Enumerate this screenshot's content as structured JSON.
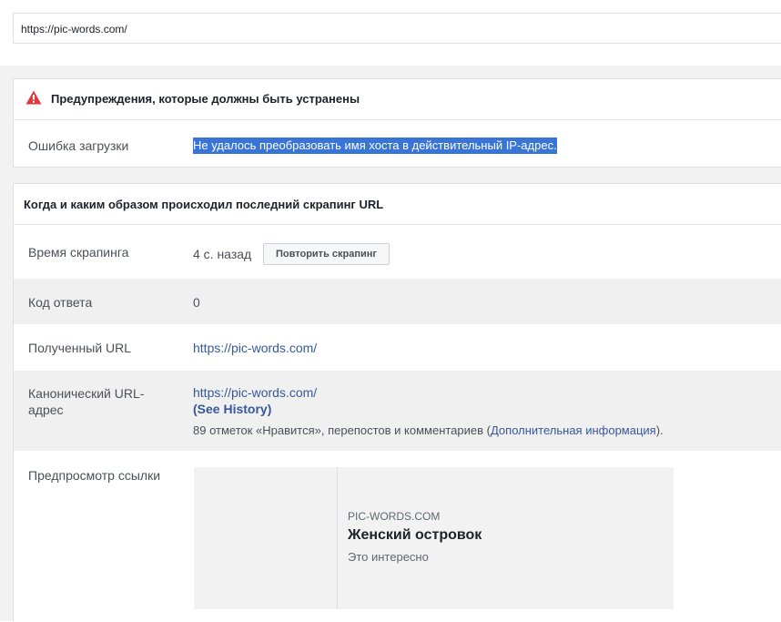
{
  "url_input": {
    "value": "https://pic-words.com/"
  },
  "warnings": {
    "title": "Предупреждения, которые должны быть устранены",
    "icon": "warning-triangle-icon",
    "rows": [
      {
        "label": "Ошибка загрузки",
        "value": "Не удалось преобразовать имя хоста в действительный IP-адрес."
      }
    ]
  },
  "scrape": {
    "title": "Когда и каким образом происходил последний скрапинг URL",
    "time": {
      "label": "Время скрапинга",
      "value": "4 с. назад",
      "button": "Повторить скрапинг"
    },
    "response": {
      "label": "Код ответа",
      "value": "0"
    },
    "fetched": {
      "label": "Полученный URL",
      "url": "https://pic-words.com/"
    },
    "canonical": {
      "label_line1": "Канонический URL-",
      "label_line2": "адрес",
      "url": "https://pic-words.com/",
      "history": "(See History)",
      "engagement_prefix": "89 отметок «Нравится», перепостов и комментариев (",
      "more_info": "Дополнительная информация",
      "engagement_suffix": ")."
    },
    "preview": {
      "label": "Предпросмотр ссылки",
      "domain": "PIC-WORDS.COM",
      "title": "Женский островок",
      "description": "Это интересно"
    }
  },
  "colors": {
    "link": "#365899",
    "warning_red": "#e0393e",
    "highlight": "#3875d7"
  }
}
